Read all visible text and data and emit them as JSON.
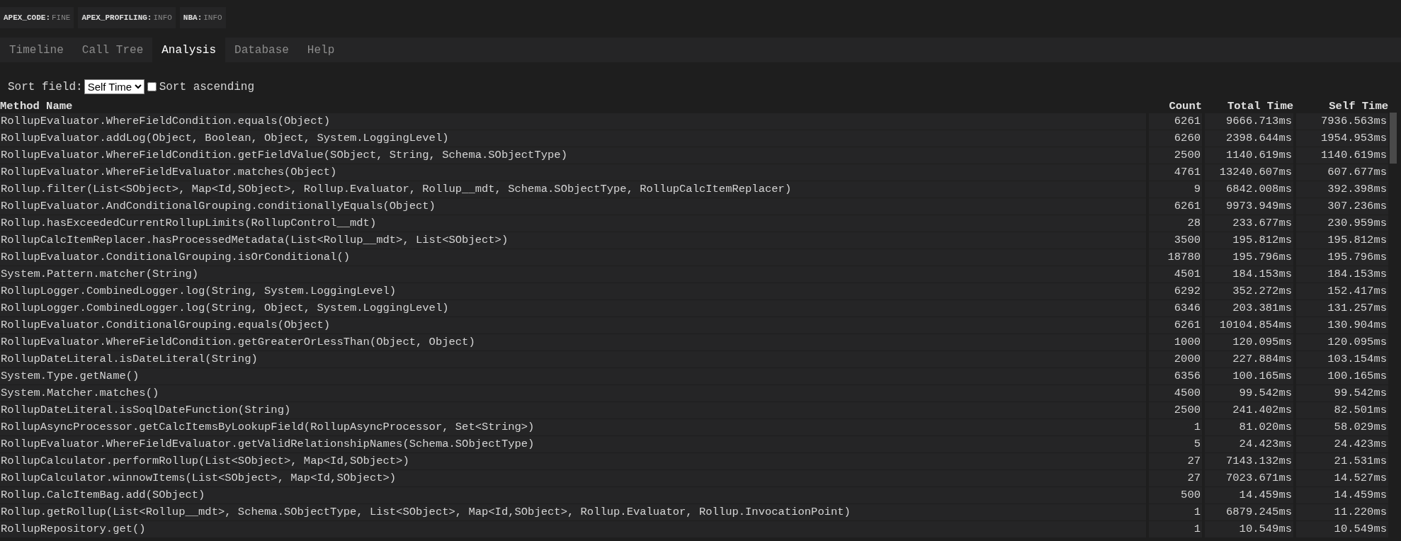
{
  "debug_levels": [
    {
      "category": "APEX_CODE:",
      "level": "FINE"
    },
    {
      "category": "APEX_PROFILING:",
      "level": "INFO"
    },
    {
      "category": "NBA:",
      "level": "INFO"
    }
  ],
  "tabs": [
    {
      "label": "Timeline",
      "selected": false
    },
    {
      "label": "Call Tree",
      "selected": false
    },
    {
      "label": "Analysis",
      "selected": true
    },
    {
      "label": "Database",
      "selected": false
    },
    {
      "label": "Help",
      "selected": false
    }
  ],
  "sort": {
    "label": "Sort field:",
    "value": "Self Time",
    "ascending_label": "Sort ascending",
    "ascending": false
  },
  "table": {
    "columns": [
      "Method Name",
      "Count",
      "Total Time",
      "Self Time"
    ],
    "rows": [
      [
        "RollupEvaluator.WhereFieldCondition.equals(Object)",
        "6261",
        "9666.713ms",
        "7936.563ms"
      ],
      [
        "RollupEvaluator.addLog(Object, Boolean, Object, System.LoggingLevel)",
        "6260",
        "2398.644ms",
        "1954.953ms"
      ],
      [
        "RollupEvaluator.WhereFieldCondition.getFieldValue(SObject, String, Schema.SObjectType)",
        "2500",
        "1140.619ms",
        "1140.619ms"
      ],
      [
        "RollupEvaluator.WhereFieldEvaluator.matches(Object)",
        "4761",
        "13240.607ms",
        "607.677ms"
      ],
      [
        "Rollup.filter(List<SObject>, Map<Id,SObject>, Rollup.Evaluator, Rollup__mdt, Schema.SObjectType, RollupCalcItemReplacer)",
        "9",
        "6842.008ms",
        "392.398ms"
      ],
      [
        "RollupEvaluator.AndConditionalGrouping.conditionallyEquals(Object)",
        "6261",
        "9973.949ms",
        "307.236ms"
      ],
      [
        "Rollup.hasExceededCurrentRollupLimits(RollupControl__mdt)",
        "28",
        "233.677ms",
        "230.959ms"
      ],
      [
        "RollupCalcItemReplacer.hasProcessedMetadata(List<Rollup__mdt>, List<SObject>)",
        "3500",
        "195.812ms",
        "195.812ms"
      ],
      [
        "RollupEvaluator.ConditionalGrouping.isOrConditional()",
        "18780",
        "195.796ms",
        "195.796ms"
      ],
      [
        "System.Pattern.matcher(String)",
        "4501",
        "184.153ms",
        "184.153ms"
      ],
      [
        "RollupLogger.CombinedLogger.log(String, System.LoggingLevel)",
        "6292",
        "352.272ms",
        "152.417ms"
      ],
      [
        "RollupLogger.CombinedLogger.log(String, Object, System.LoggingLevel)",
        "6346",
        "203.381ms",
        "131.257ms"
      ],
      [
        "RollupEvaluator.ConditionalGrouping.equals(Object)",
        "6261",
        "10104.854ms",
        "130.904ms"
      ],
      [
        "RollupEvaluator.WhereFieldCondition.getGreaterOrLessThan(Object, Object)",
        "1000",
        "120.095ms",
        "120.095ms"
      ],
      [
        "RollupDateLiteral.isDateLiteral(String)",
        "2000",
        "227.884ms",
        "103.154ms"
      ],
      [
        "System.Type.getName()",
        "6356",
        "100.165ms",
        "100.165ms"
      ],
      [
        "System.Matcher.matches()",
        "4500",
        "99.542ms",
        "99.542ms"
      ],
      [
        "RollupDateLiteral.isSoqlDateFunction(String)",
        "2500",
        "241.402ms",
        "82.501ms"
      ],
      [
        "RollupAsyncProcessor.getCalcItemsByLookupField(RollupAsyncProcessor, Set<String>)",
        "1",
        "81.020ms",
        "58.029ms"
      ],
      [
        "RollupEvaluator.WhereFieldEvaluator.getValidRelationshipNames(Schema.SObjectType)",
        "5",
        "24.423ms",
        "24.423ms"
      ],
      [
        "RollupCalculator.performRollup(List<SObject>, Map<Id,SObject>)",
        "27",
        "7143.132ms",
        "21.531ms"
      ],
      [
        "RollupCalculator.winnowItems(List<SObject>, Map<Id,SObject>)",
        "27",
        "7023.671ms",
        "14.527ms"
      ],
      [
        "Rollup.CalcItemBag.add(SObject)",
        "500",
        "14.459ms",
        "14.459ms"
      ],
      [
        "Rollup.getRollup(List<Rollup__mdt>, Schema.SObjectType, List<SObject>, Map<Id,SObject>, Rollup.Evaluator, Rollup.InvocationPoint)",
        "1",
        "6879.245ms",
        "11.220ms"
      ],
      [
        "RollupRepository.get()",
        "1",
        "10.549ms",
        "10.549ms"
      ]
    ]
  }
}
